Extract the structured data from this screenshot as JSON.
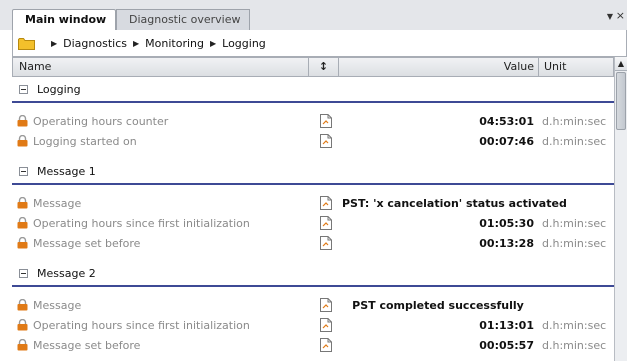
{
  "tabs": [
    {
      "label": "Main window",
      "active": true
    },
    {
      "label": "Diagnostic overview",
      "active": false
    }
  ],
  "tab_controls": {
    "menu_icon": "chevron-down-icon",
    "close_icon": "close-icon",
    "close_glyph": "×"
  },
  "breadcrumb": [
    "Diagnostics",
    "Monitoring",
    "Logging"
  ],
  "columns": {
    "name": "Name",
    "value": "Value",
    "unit": "Unit"
  },
  "colors": {
    "group_rule": "#3e4a95",
    "lock": "#e07a16",
    "folder": "#f3c02b"
  },
  "groups": [
    {
      "label": "Logging",
      "rows": [
        {
          "name": "Operating hours counter",
          "value": "04:53:01",
          "unit": "d.h:min:sec"
        },
        {
          "name": "Logging started on",
          "value": "00:07:46",
          "unit": "d.h:min:sec"
        }
      ]
    },
    {
      "label": "Message 1",
      "rows": [
        {
          "name": "Message",
          "value": "PST: 'x cancelation' status activated",
          "unit": "",
          "align": "center"
        },
        {
          "name": "Operating hours since first initialization",
          "value": "01:05:30",
          "unit": "d.h:min:sec"
        },
        {
          "name": "Message set before",
          "value": "00:13:28",
          "unit": "d.h:min:sec"
        }
      ]
    },
    {
      "label": "Message 2",
      "rows": [
        {
          "name": "Message",
          "value": "PST completed successfully",
          "unit": "",
          "align": "center"
        },
        {
          "name": "Operating hours since first initialization",
          "value": "01:13:01",
          "unit": "d.h:min:sec"
        },
        {
          "name": "Message set before",
          "value": "00:05:57",
          "unit": "d.h:min:sec"
        }
      ]
    }
  ]
}
